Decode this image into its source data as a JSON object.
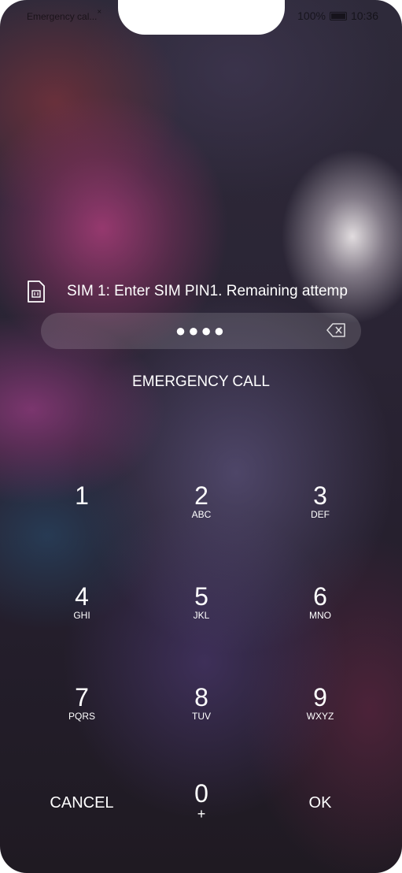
{
  "status_bar": {
    "left_text": "Emergency cal...",
    "left_mark": "×",
    "battery": "100%",
    "time": "10:36"
  },
  "sim": {
    "icon": "sim-card-icon",
    "message": "SIM 1: Enter SIM PIN1. Remaining attemp"
  },
  "pin_input": {
    "masked_value": "●●●●",
    "backspace_icon": "backspace-icon"
  },
  "emergency_call_label": "EMERGENCY CALL",
  "keypad": {
    "k1": {
      "digit": "1",
      "letters": ""
    },
    "k2": {
      "digit": "2",
      "letters": "ABC"
    },
    "k3": {
      "digit": "3",
      "letters": "DEF"
    },
    "k4": {
      "digit": "4",
      "letters": "GHI"
    },
    "k5": {
      "digit": "5",
      "letters": "JKL"
    },
    "k6": {
      "digit": "6",
      "letters": "MNO"
    },
    "k7": {
      "digit": "7",
      "letters": "PQRS"
    },
    "k8": {
      "digit": "8",
      "letters": "TUV"
    },
    "k9": {
      "digit": "9",
      "letters": "WXYZ"
    },
    "k0": {
      "digit": "0",
      "letters": "+"
    },
    "cancel": "CANCEL",
    "ok": "OK"
  }
}
